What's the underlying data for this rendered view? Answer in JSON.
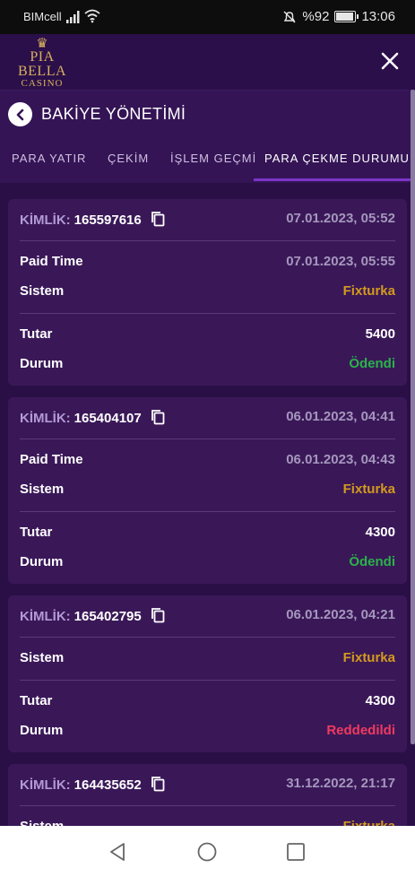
{
  "status": {
    "carrier": "BIMcell",
    "battery": "%92",
    "time": "13:06"
  },
  "brand": {
    "name": "PIA BELLA",
    "sub": "CASINO"
  },
  "page": {
    "title": "BAKİYE YÖNETİMİ"
  },
  "tabs": [
    {
      "label": "PARA YATIR",
      "active": false
    },
    {
      "label": "ÇEKİM",
      "active": false
    },
    {
      "label": "İŞLEM GEÇMİ",
      "active": false
    },
    {
      "label": "PARA ÇEKME DURUMU",
      "active": true
    }
  ],
  "labels": {
    "id": "KİMLİK:",
    "paid_time": "Paid Time",
    "system": "Sistem",
    "amount": "Tutar",
    "status": "Durum"
  },
  "cards": [
    {
      "id": "165597616",
      "date": "07.01.2023, 05:52",
      "paid_time": "07.01.2023, 05:55",
      "system": "Fixturka",
      "amount": "5400",
      "status": "Ödendi",
      "status_color": "#29b34a"
    },
    {
      "id": "165404107",
      "date": "06.01.2023, 04:41",
      "paid_time": "06.01.2023, 04:43",
      "system": "Fixturka",
      "amount": "4300",
      "status": "Ödendi",
      "status_color": "#29b34a"
    },
    {
      "id": "165402795",
      "date": "06.01.2023, 04:21",
      "system": "Fixturka",
      "amount": "4300",
      "status": "Reddedildi",
      "status_color": "#f03a5f"
    },
    {
      "id": "164435652",
      "date": "31.12.2022, 21:17",
      "system": "Fixturka"
    }
  ],
  "colors": {
    "background": "#2a0f47",
    "card": "#3a1858",
    "accent": "#7d35c9",
    "gold": "#d39a1e",
    "paid": "#29b34a",
    "rejected": "#f03a5f"
  },
  "icons": {
    "close": "close-icon",
    "back": "chevron-left-icon",
    "copy": "copy-icon"
  }
}
